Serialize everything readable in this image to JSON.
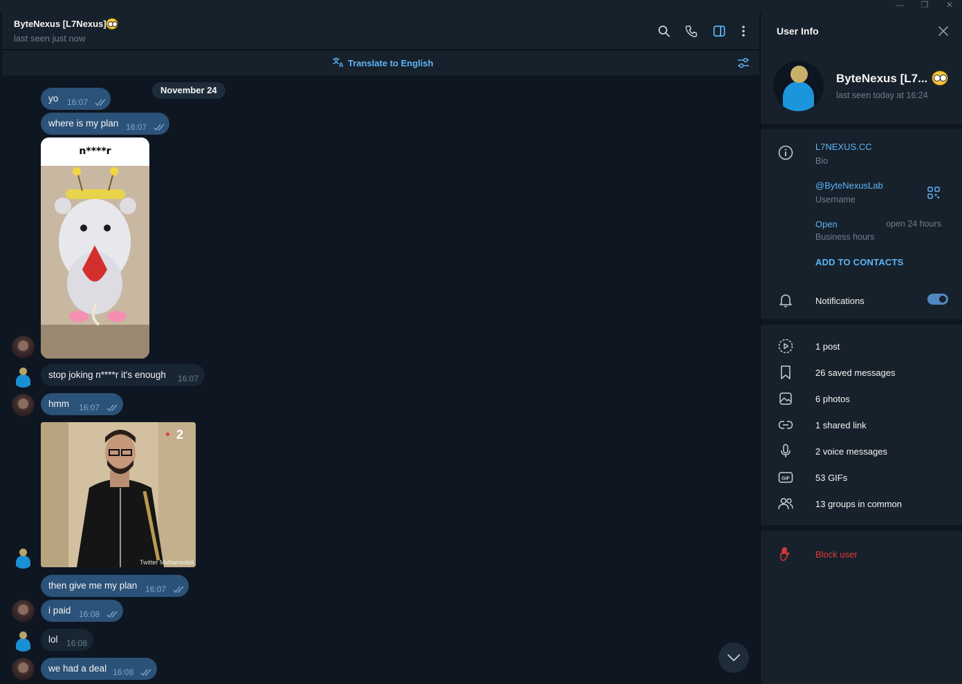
{
  "window": {
    "minimize_glyph": "—",
    "restore_glyph": "❐",
    "close_glyph": "✕"
  },
  "chat": {
    "contact_name": "ByteNexus [L7Nexus]",
    "contact_status": "last seen just now",
    "header_icons": [
      "search-icon",
      "phone-icon",
      "sidebar-toggle-icon",
      "more-icon"
    ],
    "translate_label": "Translate to English",
    "date_label": "November 24",
    "messages": [
      {
        "text": "yo",
        "time": "16:07",
        "dir": "out"
      },
      {
        "text": "where is my plan",
        "time": "16:07",
        "dir": "out"
      },
      {
        "caption": "n****r",
        "kind": "gif",
        "dir": "out"
      },
      {
        "text": "stop joking n****r it's enough",
        "time": "16:07",
        "dir": "in"
      },
      {
        "text": "hmm",
        "time": "16:07",
        "dir": "out"
      },
      {
        "kind": "gif",
        "dir": "in",
        "channel_badge": "2",
        "watermark": "Twitter Mohamedell"
      },
      {
        "text": "then give me my plan",
        "time": "16:07",
        "dir": "out"
      },
      {
        "text": "i paid",
        "time": "16:08",
        "dir": "out"
      },
      {
        "text": "lol",
        "time": "16:08",
        "dir": "in"
      },
      {
        "text": "we had a deal",
        "time": "16:08",
        "dir": "out"
      }
    ]
  },
  "panel": {
    "title": "User Info",
    "name": "ByteNexus [L7...",
    "status": "last seen today at 16:24",
    "bio_value": "L7NEXUS.CC",
    "bio_label": "Bio",
    "username_value": "@ByteNexusLab",
    "username_label": "Username",
    "hours_value": "Open",
    "hours_detail": "open 24 hours",
    "hours_label": "Business hours",
    "add_contacts": "ADD TO CONTACTS",
    "notifications_label": "Notifications",
    "notifications_on": true,
    "media": [
      {
        "icon": "stories-icon",
        "label": "1 post"
      },
      {
        "icon": "bookmark-icon",
        "label": "26 saved messages"
      },
      {
        "icon": "photo-icon",
        "label": "6 photos"
      },
      {
        "icon": "link-icon",
        "label": "1 shared link"
      },
      {
        "icon": "microphone-icon",
        "label": "2 voice messages"
      },
      {
        "icon": "gif-icon",
        "label": "53 GIFs"
      },
      {
        "icon": "group-icon",
        "label": "13 groups in common"
      }
    ],
    "block_label": "Block user",
    "colors": {
      "accent": "#5eb5f7",
      "danger": "#e53935",
      "bubble_out": "#2b5278",
      "bubble_in": "#182533"
    }
  }
}
